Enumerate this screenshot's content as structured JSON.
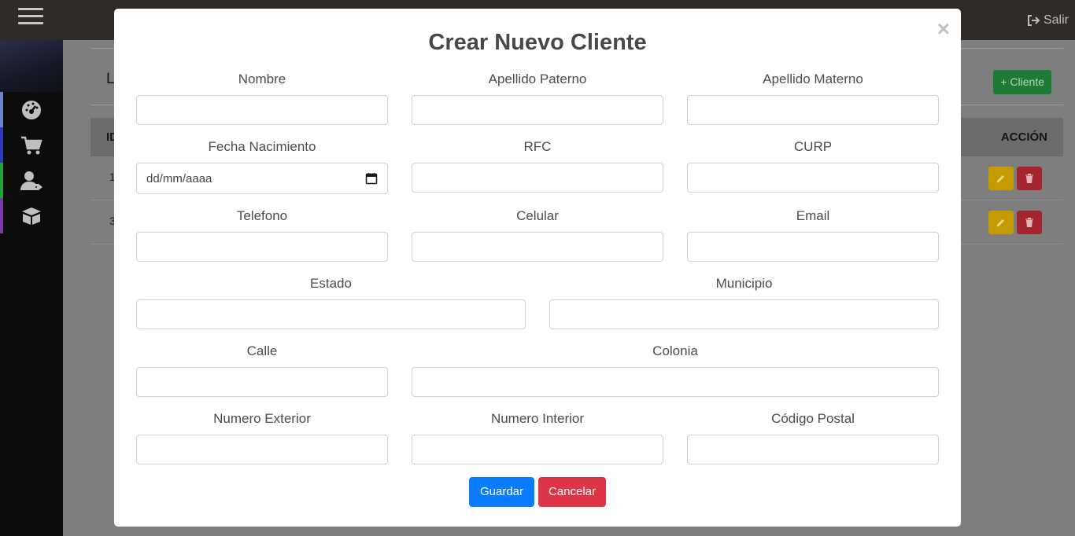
{
  "topbar": {
    "logout_label": "Salir",
    "menu_icon": "hamburger-icon",
    "logout_icon": "sign-out-icon"
  },
  "sidebar": {
    "items": [
      {
        "icon": "dashboard-icon",
        "color": "#6b86c6"
      },
      {
        "icon": "cart-icon",
        "color": "#2f3bb5"
      },
      {
        "icon": "user-tag-icon",
        "color": "#23a03a"
      },
      {
        "icon": "box-open-icon",
        "color": "#7a3fa0"
      }
    ]
  },
  "content": {
    "title": "L",
    "add_button_label": "+ Cliente",
    "table": {
      "headers": {
        "id": "ID",
        "accion": "ACCIÓN"
      },
      "rows": [
        {
          "id": "1"
        },
        {
          "id": "3"
        }
      ]
    }
  },
  "modal": {
    "title": "Crear Nuevo Cliente",
    "close_symbol": "×",
    "fields": {
      "nombre": {
        "label": "Nombre",
        "value": ""
      },
      "apellido_paterno": {
        "label": "Apellido Paterno",
        "value": ""
      },
      "apellido_materno": {
        "label": "Apellido Materno",
        "value": ""
      },
      "fecha_nacimiento": {
        "label": "Fecha Nacimiento",
        "value": "dd/mm/aaaa"
      },
      "rfc": {
        "label": "RFC",
        "value": ""
      },
      "curp": {
        "label": "CURP",
        "value": ""
      },
      "telefono": {
        "label": "Telefono",
        "value": ""
      },
      "celular": {
        "label": "Celular",
        "value": ""
      },
      "email": {
        "label": "Email",
        "value": ""
      },
      "estado": {
        "label": "Estado",
        "value": ""
      },
      "municipio": {
        "label": "Municipio",
        "value": ""
      },
      "calle": {
        "label": "Calle",
        "value": ""
      },
      "colonia": {
        "label": "Colonia",
        "value": ""
      },
      "numero_exterior": {
        "label": "Numero Exterior",
        "value": ""
      },
      "numero_interior": {
        "label": "Numero Interior",
        "value": ""
      },
      "codigo_postal": {
        "label": "Código Postal",
        "value": ""
      }
    },
    "buttons": {
      "save": "Guardar",
      "cancel": "Cancelar"
    }
  },
  "colors": {
    "primary": "#0b7bff",
    "danger": "#dd3545",
    "success": "#28a745",
    "warning": "#ffc107"
  }
}
